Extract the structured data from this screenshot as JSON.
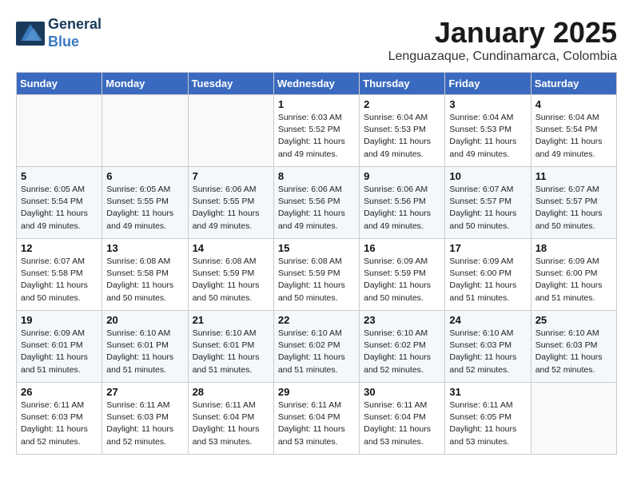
{
  "header": {
    "logo_line1": "General",
    "logo_line2": "Blue",
    "month": "January 2025",
    "location": "Lenguazaque, Cundinamarca, Colombia"
  },
  "weekdays": [
    "Sunday",
    "Monday",
    "Tuesday",
    "Wednesday",
    "Thursday",
    "Friday",
    "Saturday"
  ],
  "weeks": [
    [
      {
        "day": "",
        "sunrise": "",
        "sunset": "",
        "daylight": "",
        "empty": true
      },
      {
        "day": "",
        "sunrise": "",
        "sunset": "",
        "daylight": "",
        "empty": true
      },
      {
        "day": "",
        "sunrise": "",
        "sunset": "",
        "daylight": "",
        "empty": true
      },
      {
        "day": "1",
        "sunrise": "Sunrise: 6:03 AM",
        "sunset": "Sunset: 5:52 PM",
        "daylight": "Daylight: 11 hours and 49 minutes.",
        "empty": false
      },
      {
        "day": "2",
        "sunrise": "Sunrise: 6:04 AM",
        "sunset": "Sunset: 5:53 PM",
        "daylight": "Daylight: 11 hours and 49 minutes.",
        "empty": false
      },
      {
        "day": "3",
        "sunrise": "Sunrise: 6:04 AM",
        "sunset": "Sunset: 5:53 PM",
        "daylight": "Daylight: 11 hours and 49 minutes.",
        "empty": false
      },
      {
        "day": "4",
        "sunrise": "Sunrise: 6:04 AM",
        "sunset": "Sunset: 5:54 PM",
        "daylight": "Daylight: 11 hours and 49 minutes.",
        "empty": false
      }
    ],
    [
      {
        "day": "5",
        "sunrise": "Sunrise: 6:05 AM",
        "sunset": "Sunset: 5:54 PM",
        "daylight": "Daylight: 11 hours and 49 minutes.",
        "empty": false
      },
      {
        "day": "6",
        "sunrise": "Sunrise: 6:05 AM",
        "sunset": "Sunset: 5:55 PM",
        "daylight": "Daylight: 11 hours and 49 minutes.",
        "empty": false
      },
      {
        "day": "7",
        "sunrise": "Sunrise: 6:06 AM",
        "sunset": "Sunset: 5:55 PM",
        "daylight": "Daylight: 11 hours and 49 minutes.",
        "empty": false
      },
      {
        "day": "8",
        "sunrise": "Sunrise: 6:06 AM",
        "sunset": "Sunset: 5:56 PM",
        "daylight": "Daylight: 11 hours and 49 minutes.",
        "empty": false
      },
      {
        "day": "9",
        "sunrise": "Sunrise: 6:06 AM",
        "sunset": "Sunset: 5:56 PM",
        "daylight": "Daylight: 11 hours and 49 minutes.",
        "empty": false
      },
      {
        "day": "10",
        "sunrise": "Sunrise: 6:07 AM",
        "sunset": "Sunset: 5:57 PM",
        "daylight": "Daylight: 11 hours and 50 minutes.",
        "empty": false
      },
      {
        "day": "11",
        "sunrise": "Sunrise: 6:07 AM",
        "sunset": "Sunset: 5:57 PM",
        "daylight": "Daylight: 11 hours and 50 minutes.",
        "empty": false
      }
    ],
    [
      {
        "day": "12",
        "sunrise": "Sunrise: 6:07 AM",
        "sunset": "Sunset: 5:58 PM",
        "daylight": "Daylight: 11 hours and 50 minutes.",
        "empty": false
      },
      {
        "day": "13",
        "sunrise": "Sunrise: 6:08 AM",
        "sunset": "Sunset: 5:58 PM",
        "daylight": "Daylight: 11 hours and 50 minutes.",
        "empty": false
      },
      {
        "day": "14",
        "sunrise": "Sunrise: 6:08 AM",
        "sunset": "Sunset: 5:59 PM",
        "daylight": "Daylight: 11 hours and 50 minutes.",
        "empty": false
      },
      {
        "day": "15",
        "sunrise": "Sunrise: 6:08 AM",
        "sunset": "Sunset: 5:59 PM",
        "daylight": "Daylight: 11 hours and 50 minutes.",
        "empty": false
      },
      {
        "day": "16",
        "sunrise": "Sunrise: 6:09 AM",
        "sunset": "Sunset: 5:59 PM",
        "daylight": "Daylight: 11 hours and 50 minutes.",
        "empty": false
      },
      {
        "day": "17",
        "sunrise": "Sunrise: 6:09 AM",
        "sunset": "Sunset: 6:00 PM",
        "daylight": "Daylight: 11 hours and 51 minutes.",
        "empty": false
      },
      {
        "day": "18",
        "sunrise": "Sunrise: 6:09 AM",
        "sunset": "Sunset: 6:00 PM",
        "daylight": "Daylight: 11 hours and 51 minutes.",
        "empty": false
      }
    ],
    [
      {
        "day": "19",
        "sunrise": "Sunrise: 6:09 AM",
        "sunset": "Sunset: 6:01 PM",
        "daylight": "Daylight: 11 hours and 51 minutes.",
        "empty": false
      },
      {
        "day": "20",
        "sunrise": "Sunrise: 6:10 AM",
        "sunset": "Sunset: 6:01 PM",
        "daylight": "Daylight: 11 hours and 51 minutes.",
        "empty": false
      },
      {
        "day": "21",
        "sunrise": "Sunrise: 6:10 AM",
        "sunset": "Sunset: 6:01 PM",
        "daylight": "Daylight: 11 hours and 51 minutes.",
        "empty": false
      },
      {
        "day": "22",
        "sunrise": "Sunrise: 6:10 AM",
        "sunset": "Sunset: 6:02 PM",
        "daylight": "Daylight: 11 hours and 51 minutes.",
        "empty": false
      },
      {
        "day": "23",
        "sunrise": "Sunrise: 6:10 AM",
        "sunset": "Sunset: 6:02 PM",
        "daylight": "Daylight: 11 hours and 52 minutes.",
        "empty": false
      },
      {
        "day": "24",
        "sunrise": "Sunrise: 6:10 AM",
        "sunset": "Sunset: 6:03 PM",
        "daylight": "Daylight: 11 hours and 52 minutes.",
        "empty": false
      },
      {
        "day": "25",
        "sunrise": "Sunrise: 6:10 AM",
        "sunset": "Sunset: 6:03 PM",
        "daylight": "Daylight: 11 hours and 52 minutes.",
        "empty": false
      }
    ],
    [
      {
        "day": "26",
        "sunrise": "Sunrise: 6:11 AM",
        "sunset": "Sunset: 6:03 PM",
        "daylight": "Daylight: 11 hours and 52 minutes.",
        "empty": false
      },
      {
        "day": "27",
        "sunrise": "Sunrise: 6:11 AM",
        "sunset": "Sunset: 6:03 PM",
        "daylight": "Daylight: 11 hours and 52 minutes.",
        "empty": false
      },
      {
        "day": "28",
        "sunrise": "Sunrise: 6:11 AM",
        "sunset": "Sunset: 6:04 PM",
        "daylight": "Daylight: 11 hours and 53 minutes.",
        "empty": false
      },
      {
        "day": "29",
        "sunrise": "Sunrise: 6:11 AM",
        "sunset": "Sunset: 6:04 PM",
        "daylight": "Daylight: 11 hours and 53 minutes.",
        "empty": false
      },
      {
        "day": "30",
        "sunrise": "Sunrise: 6:11 AM",
        "sunset": "Sunset: 6:04 PM",
        "daylight": "Daylight: 11 hours and 53 minutes.",
        "empty": false
      },
      {
        "day": "31",
        "sunrise": "Sunrise: 6:11 AM",
        "sunset": "Sunset: 6:05 PM",
        "daylight": "Daylight: 11 hours and 53 minutes.",
        "empty": false
      },
      {
        "day": "",
        "sunrise": "",
        "sunset": "",
        "daylight": "",
        "empty": true
      }
    ]
  ]
}
